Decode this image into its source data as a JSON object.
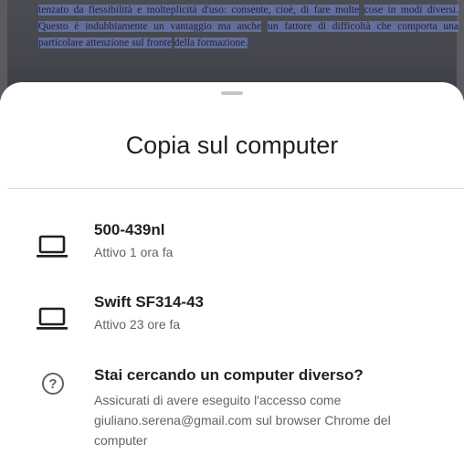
{
  "background": {
    "document_lines": [
      "tenzato da flessibilità e molteplicità d'uso: consente, cioè, di fare molte",
      "cose in modi diversi. Questo è indubbiamente un vantaggio ma anche",
      "un fattore di difficoltà che comporta una particolare attenzione sul fronte",
      "della formazione."
    ]
  },
  "sheet": {
    "title": "Copia sul computer",
    "devices": [
      {
        "name": "500-439nl",
        "status": "Attivo 1 ora fa",
        "icon": "laptop-icon"
      },
      {
        "name": "Swift SF314-43",
        "status": "Attivo 23 ore fa",
        "icon": "laptop-icon"
      }
    ],
    "help": {
      "icon": "help-circle-icon",
      "title": "Stai cercando un computer diverso?",
      "body": "Assicurati di avere eseguito l'accesso come giuliano.serena@gmail.com sul browser Chrome del computer"
    }
  },
  "colors": {
    "highlight": "#788cdc",
    "primary_text": "#202124",
    "secondary_text": "#5f6368"
  }
}
